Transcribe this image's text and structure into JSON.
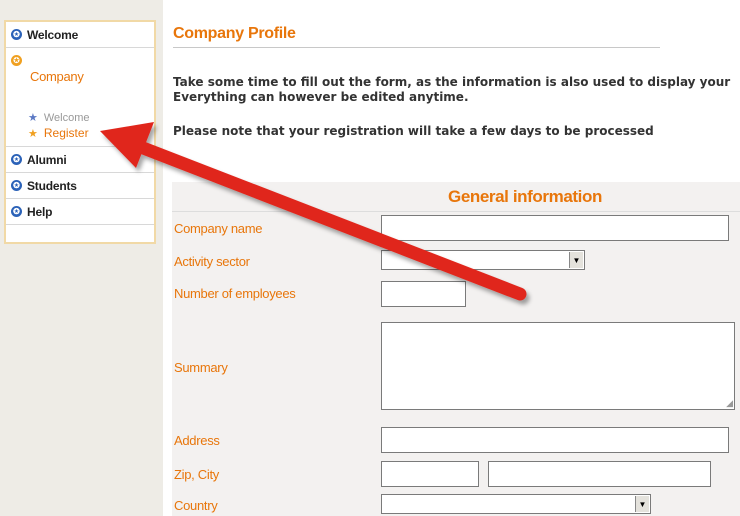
{
  "sidebar": {
    "items": [
      {
        "label": "Welcome"
      },
      {
        "label": "Company"
      },
      {
        "label": "Alumni"
      },
      {
        "label": "Students"
      },
      {
        "label": "Help"
      }
    ],
    "company_sub": [
      {
        "label": "Welcome"
      },
      {
        "label": "Register"
      }
    ]
  },
  "main": {
    "title": "Company Profile",
    "intro_line1": "Take some time to fill out the form, as the information is also used to display your",
    "intro_line2": "Everything can however be edited anytime.",
    "note": "Please note that your registration will take a few days to be processed"
  },
  "form": {
    "section_title": "General information",
    "fields": {
      "company_name": {
        "label": "Company name",
        "value": ""
      },
      "activity_sector": {
        "label": "Activity sector",
        "value": ""
      },
      "employees": {
        "label": "Number of employees",
        "value": ""
      },
      "summary": {
        "label": "Summary",
        "value": ""
      },
      "address": {
        "label": "Address",
        "value": ""
      },
      "zip_city": {
        "label": "Zip, City",
        "zip": "",
        "city": ""
      },
      "country": {
        "label": "Country",
        "value": ""
      }
    }
  },
  "icons": {
    "nav_bullet": "blue-circle-icon",
    "active_bullet": "orange-circle-icon",
    "sub_bullet": "star-icon",
    "dropdown": "dropdown-arrow-icon",
    "annotation": "red-arrow-icon"
  },
  "colors": {
    "accent": "#e8760b",
    "nav_blue": "#2b62b8",
    "sidebar_bg": "#eeece6",
    "sidebar_border": "#f1d9a6",
    "form_bg": "#f3f1f0",
    "annotation_red": "#e0281e"
  }
}
